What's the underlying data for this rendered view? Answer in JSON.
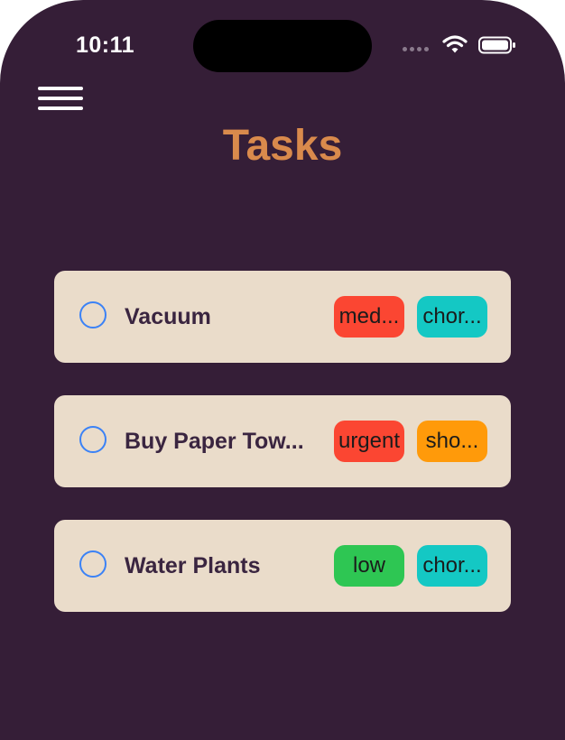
{
  "status_bar": {
    "time": "10:11"
  },
  "header": {
    "menu_icon": "hamburger-menu-icon",
    "title": "Tasks"
  },
  "colors": {
    "background": "#351e37",
    "title": "#d98a4c",
    "card": "#eadcca",
    "check_ring": "#3b82f6"
  },
  "tasks": [
    {
      "title": "Vacuum",
      "tags": [
        {
          "label": "med...",
          "color": "#fb4632"
        },
        {
          "label": "chor...",
          "color": "#14c8c4"
        }
      ]
    },
    {
      "title": "Buy Paper Tow...",
      "tags": [
        {
          "label": "urgent",
          "color": "#fb4632"
        },
        {
          "label": "sho...",
          "color": "#ff9a0a"
        }
      ]
    },
    {
      "title": "Water Plants",
      "tags": [
        {
          "label": "low",
          "color": "#2ec653"
        },
        {
          "label": "chor...",
          "color": "#14c8c4"
        }
      ]
    }
  ]
}
